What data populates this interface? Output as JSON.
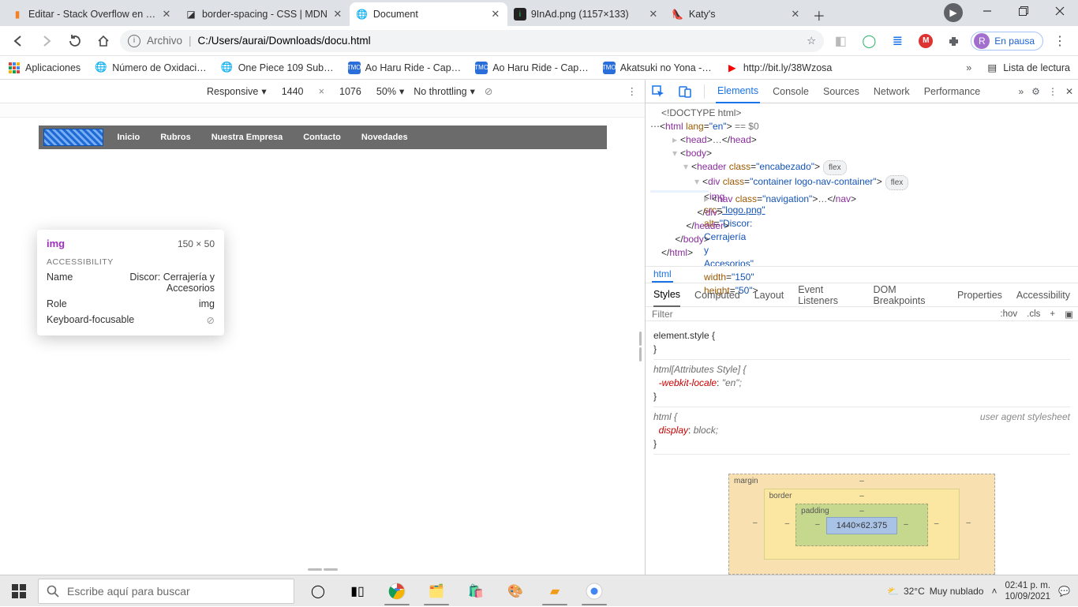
{
  "tabs": [
    {
      "title": "Editar - Stack Overflow en esp",
      "favicon": "so"
    },
    {
      "title": "border-spacing - CSS | MDN",
      "favicon": "mdn"
    },
    {
      "title": "Document",
      "favicon": "globe",
      "active": true
    },
    {
      "title": "9InAd.png (1157×133)",
      "favicon": "imgur"
    },
    {
      "title": "Katy's",
      "favicon": "katy"
    }
  ],
  "url": {
    "scheme": "Archivo",
    "path": "C:/Users/aurai/Downloads/docu.html"
  },
  "profile": {
    "label": "En pausa",
    "initial": "R"
  },
  "bookmarks": [
    "Aplicaciones",
    "Número de Oxidaci…",
    "One Piece 109 Sub…",
    "Ao Haru Ride - Cap…",
    "Ao Haru Ride - Cap…",
    "Akatsuki no Yona -…",
    "http://bit.ly/38Wzosa"
  ],
  "bookmarks_right": "Lista de lectura",
  "device_bar": {
    "device": "Responsive",
    "w": "1440",
    "h": "1076",
    "zoom": "50%",
    "throttle": "No throttling"
  },
  "page_nav": [
    "Inicio",
    "Rubros",
    "Nuestra Empresa",
    "Contacto",
    "Novedades"
  ],
  "tooltip": {
    "tag": "img",
    "dims": "150 × 50",
    "section": "ACCESSIBILITY",
    "rows": [
      {
        "k": "Name",
        "v": "Discor: Cerrajería y Accesorios"
      },
      {
        "k": "Role",
        "v": "img"
      },
      {
        "k": "Keyboard-focusable",
        "v": "⊘"
      }
    ]
  },
  "devtools": {
    "tabs": [
      "Elements",
      "Console",
      "Sources",
      "Network",
      "Performance"
    ],
    "active_tab": "Elements",
    "crumbs": "html",
    "styles_tabs": [
      "Styles",
      "Computed",
      "Layout",
      "Event Listeners",
      "DOM Breakpoints",
      "Properties",
      "Accessibility"
    ],
    "styles_active": "Styles",
    "filter_placeholder": "Filter",
    "filter_actions": [
      ":hov",
      ".cls",
      "+"
    ],
    "rules": {
      "elementStyle": "element.style {",
      "attrStyleSel": "html[Attributes Style] {",
      "attrStyleProp": "-webkit-locale",
      "attrStyleVal": "\"en\";",
      "uaSel": "html {",
      "uaSrc": "user agent stylesheet",
      "uaProp": "display",
      "uaVal": "block;"
    },
    "boxmodel": {
      "content": "1440×62.375",
      "margin": "margin",
      "border": "border",
      "padding": "padding"
    }
  },
  "dom": {
    "doctype": "<!DOCTYPE html>",
    "htmlOpen1": "<html ",
    "langAttr": "lang",
    "langVal": "\"en\"",
    "htmlOpen2": ">",
    "eqDollar": " == $0",
    "headOpen": "<head>",
    "headDots": "…",
    "headClose": "</head>",
    "bodyOpen": "<body>",
    "headerOpen1": "<header ",
    "headerClassAttr": "class",
    "headerClassVal": "\"encabezado\"",
    "headerOpen2": ">",
    "pillFlex": "flex",
    "divOpen1": "<div ",
    "divClassVal": "\"container logo-nav-container\"",
    "divOpen2": ">",
    "imgOpen": "<img ",
    "srcAttr": "src",
    "srcVal": "\"logo.png\"",
    "altAttr": "alt",
    "altVal": "\"Discor: Cerrajería y Accesorios\"",
    "widthAttr": "width",
    "widthVal": "\"150\"",
    "heightAttr": "height",
    "heightVal": "\"50\"",
    "imgClose": ">",
    "navOpen1": "<nav ",
    "navClassVal": "\"navigation\"",
    "navOpen2": ">",
    "navDots": "…",
    "navClose": "</nav>",
    "divClose": "</div>",
    "headerClose": "</header>",
    "bodyClose": "</body>",
    "htmlClose": "</html>"
  },
  "taskbar": {
    "search_placeholder": "Escribe aquí para buscar",
    "weather_temp": "32°C",
    "weather_text": "Muy nublado",
    "time": "02:41 p. m.",
    "date": "10/09/2021"
  }
}
